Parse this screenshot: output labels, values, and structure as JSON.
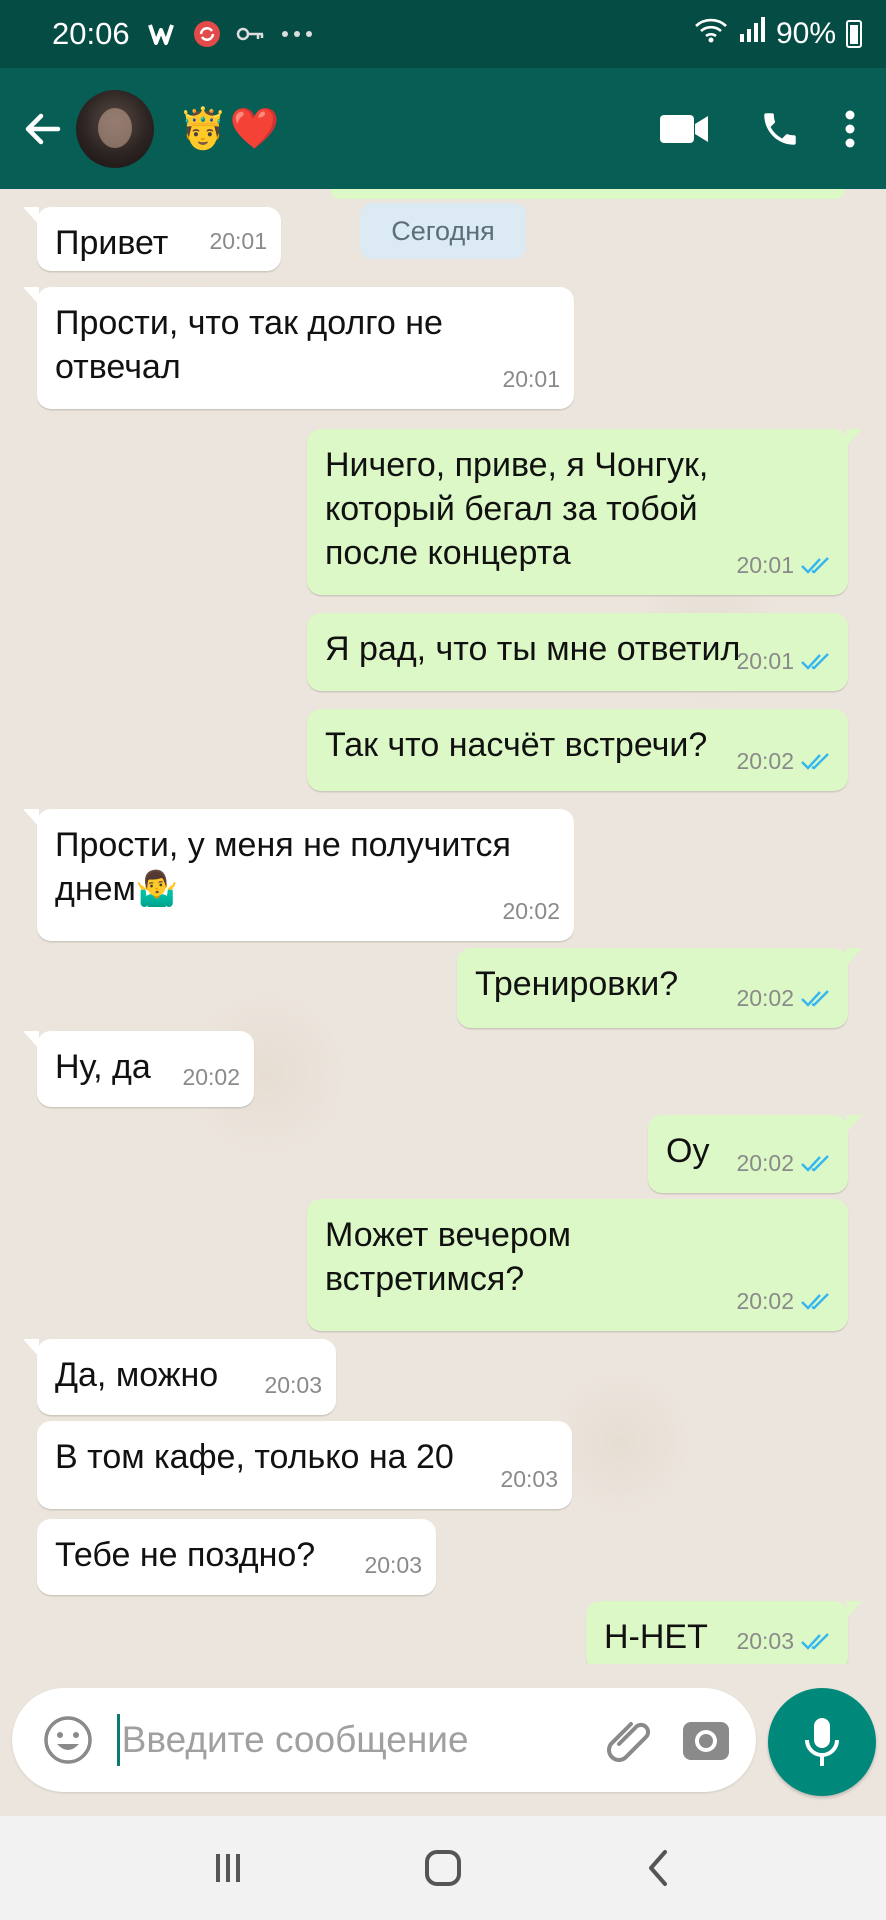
{
  "status_bar": {
    "time": "20:06",
    "battery": "90%",
    "icons": [
      "w-app-icon",
      "sync-icon",
      "key-icon",
      "more-dots",
      "wifi-icon",
      "signal-icon",
      "battery-icon"
    ]
  },
  "header": {
    "contact_name": "🤴❤️",
    "icons": [
      "back-arrow-icon",
      "avatar",
      "video-call-icon",
      "phone-icon",
      "more-vert-icon"
    ]
  },
  "chat": {
    "date_label": "Сегодня",
    "messages": [
      {
        "dir": "in",
        "text": "Привет",
        "time": "20:01"
      },
      {
        "dir": "in",
        "text": "Прости, что так долго не\nотвечал",
        "time": "20:01"
      },
      {
        "dir": "out",
        "text": "Ничего, приве, я Чонгук,\nкоторый бегал за тобой\nпосле концерта",
        "time": "20:01"
      },
      {
        "dir": "out",
        "text": "Я рад, что ты мне ответил",
        "time": "20:01"
      },
      {
        "dir": "out",
        "text": "Так что насчёт встречи?",
        "time": "20:02"
      },
      {
        "dir": "in",
        "text": "Прости, у меня не получится\nднем🤷‍♂️",
        "time": "20:02"
      },
      {
        "dir": "out",
        "text": "Тренировки?",
        "time": "20:02"
      },
      {
        "dir": "in",
        "text": "Ну, да",
        "time": "20:02"
      },
      {
        "dir": "out",
        "text": "Оу",
        "time": "20:02"
      },
      {
        "dir": "out",
        "text": "Может вечером\nвстретимся?",
        "time": "20:02"
      },
      {
        "dir": "in",
        "text": "Да, можно",
        "time": "20:03"
      },
      {
        "dir": "in",
        "text": "В том кафе, только на 20",
        "time": "20:03"
      },
      {
        "dir": "in",
        "text": "Тебе не поздно?",
        "time": "20:03"
      },
      {
        "dir": "out",
        "text": "Н-НЕТ",
        "time": "20:03"
      }
    ]
  },
  "input": {
    "placeholder": "Введите сообщение",
    "value": ""
  },
  "colors": {
    "header": "#075e54",
    "status_bar": "#054d44",
    "outgoing_bubble": "#dcf8c6",
    "incoming_bubble": "#ffffff",
    "chat_bg": "#ece5dd",
    "mic_button": "#00897b",
    "read_ticks": "#34b7f1"
  }
}
